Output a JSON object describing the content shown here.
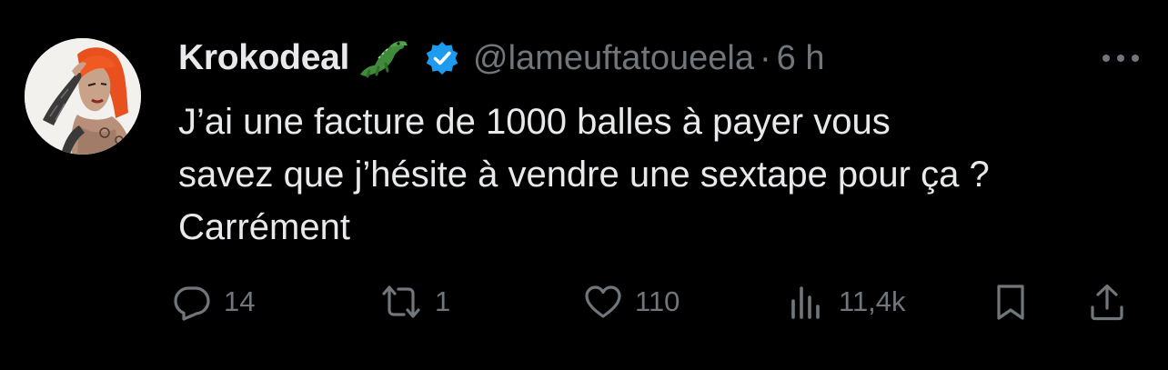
{
  "tweet": {
    "display_name": "Krokodeal",
    "handle": "@lameuftatoueela",
    "separator": "·",
    "time": "6 h",
    "text_lines": [
      "J’ai une facture de 1000 balles à payer vous",
      "savez que j’hésite à vendre une sextape pour ça ?",
      "Carrément"
    ],
    "name_emoji_icon": "crocodile-icon",
    "verified_icon": "verified-badge-icon"
  },
  "actions": {
    "reply": {
      "icon": "reply-icon",
      "count": "14"
    },
    "retweet": {
      "icon": "retweet-icon",
      "count": "1"
    },
    "like": {
      "icon": "heart-icon",
      "count": "110"
    },
    "views": {
      "icon": "views-icon",
      "count": "11,4k"
    },
    "bookmark": {
      "icon": "bookmark-icon"
    },
    "share": {
      "icon": "share-icon"
    }
  },
  "colors": {
    "background": "#000000",
    "primary_text": "#e7e9ea",
    "secondary_text": "#71767b",
    "verified_blue": "#1d9bf0",
    "avatar_hair": "#e8501e"
  }
}
